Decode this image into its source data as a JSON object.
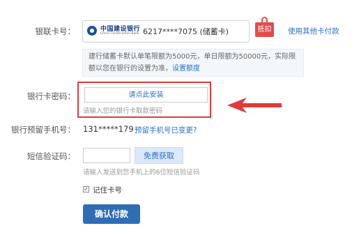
{
  "labels": {
    "card": "银联卡号：",
    "password": "银行卡密码：",
    "phone": "银行预留手机号：",
    "sms": "短信验证码："
  },
  "card": {
    "bank_name_cn": "中国建设银行",
    "bank_name_en": "China Construction Bank",
    "number_masked": "6217****7075 (储蓄卡)",
    "deduct_tag": "抵扣",
    "other_card_link": "使用其他卡付款"
  },
  "notice": {
    "text": "建行储蓄卡默认单笔限额为5000元，单日限额为50000元，实际限额以您在银行的设置为准，",
    "link": "设置额度"
  },
  "password": {
    "install_button": "请点此安装",
    "hint": "请输入您的银行卡取款密码"
  },
  "phone": {
    "value": "131*****179",
    "change_link": "预留手机号已变更?"
  },
  "sms": {
    "input_value": "",
    "get_code_button": "免费获取",
    "hint": "请输入发送到您手机上的6位短信验证码"
  },
  "remember": {
    "checked": true,
    "check_mark": "✓",
    "label": "记住卡号"
  },
  "submit": {
    "label": "确认付款"
  },
  "colors": {
    "accent_red": "#e23a3a",
    "link_blue": "#2a6fc9",
    "button_blue": "#2f6db5"
  }
}
